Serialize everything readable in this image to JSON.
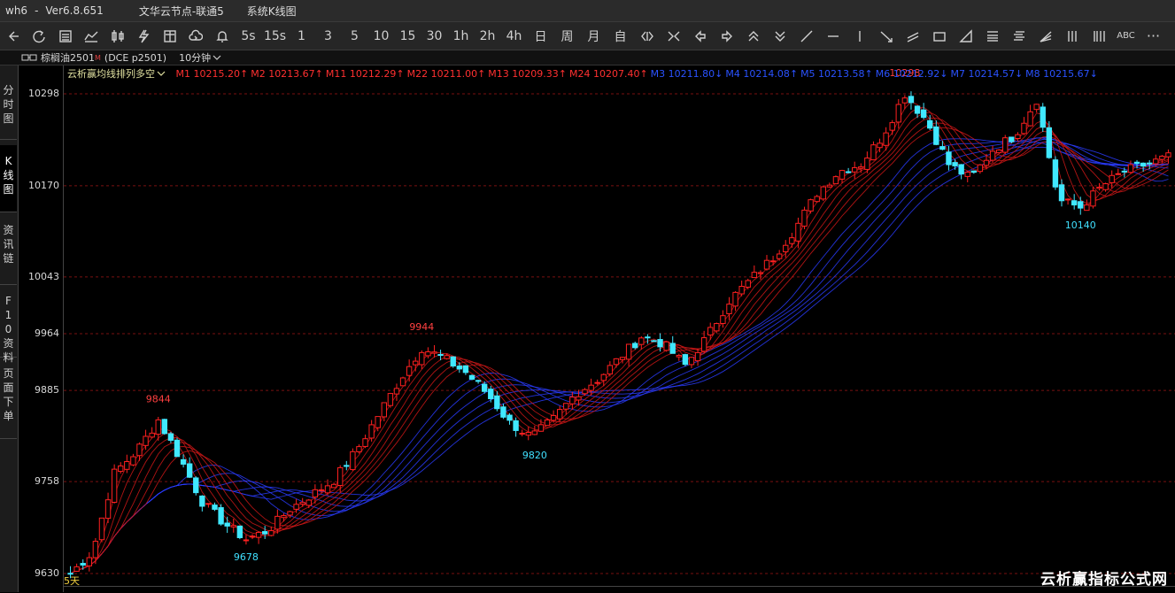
{
  "titlebar": {
    "app": "wh6",
    "sep": "-",
    "version": "Ver6.8.651",
    "node": "文华云节点-联通5",
    "view": "系统K线图"
  },
  "toolbar": {
    "text_buttons": [
      "5s",
      "15s",
      "1",
      "3",
      "5",
      "10",
      "15",
      "30",
      "1h",
      "2h",
      "4h",
      "日",
      "周",
      "月",
      "自"
    ],
    "abc": "ABC",
    "more": "···"
  },
  "infobar": {
    "symbol": "棕榈油2501",
    "sup": "M",
    "code": "(DCE p2501)",
    "period": "10分钟"
  },
  "sidebar": [
    "分时图",
    "K线图",
    "资讯链",
    "F10资料",
    "页面下单"
  ],
  "legend": {
    "name": "云析赢均线排列多空",
    "items": [
      {
        "text": "M1 10215.20↑",
        "color": "#ff3030"
      },
      {
        "text": "M2 10213.67↑",
        "color": "#ff3030"
      },
      {
        "text": "M11 10212.29↑",
        "color": "#ff3030"
      },
      {
        "text": "M22 10211.00↑",
        "color": "#ff3030"
      },
      {
        "text": "M13 10209.33↑",
        "color": "#ff3030"
      },
      {
        "text": "M24 10207.40↑",
        "color": "#ff3030"
      },
      {
        "text": "M3 10211.80↓",
        "color": "#2a52ff"
      },
      {
        "text": "M4 10214.08↑",
        "color": "#2a52ff"
      },
      {
        "text": "M5 10213.58↑",
        "color": "#2a52ff"
      },
      {
        "text": "M6 10212.92↓",
        "color": "#2a52ff"
      },
      {
        "text": "M7 10214.57↓",
        "color": "#2a52ff"
      },
      {
        "text": "M8 10215.67↓",
        "color": "#2a52ff"
      }
    ]
  },
  "yaxis_labels": [
    "10298",
    "10170",
    "10043",
    "9964",
    "9885",
    "9758",
    "9630"
  ],
  "annotations": [
    {
      "text": "9844",
      "color": "#ff4040"
    },
    {
      "text": "9678",
      "color": "#40e0ff"
    },
    {
      "text": "9944",
      "color": "#ff4040"
    },
    {
      "text": "9820",
      "color": "#40e0ff"
    },
    {
      "text": "10298",
      "color": "#ff4040"
    },
    {
      "text": "10140",
      "color": "#40e0ff"
    }
  ],
  "fiveday": "5天",
  "watermark": "云析赢指标公式网",
  "chart_data": {
    "type": "candlestick",
    "ylim": [
      9630,
      10298
    ],
    "price_path": [
      9630,
      9660,
      9770,
      9800,
      9844,
      9790,
      9730,
      9700,
      9678,
      9690,
      9720,
      9740,
      9760,
      9800,
      9850,
      9900,
      9944,
      9930,
      9910,
      9880,
      9840,
      9820,
      9845,
      9880,
      9900,
      9930,
      9960,
      9950,
      9920,
      9960,
      10010,
      10040,
      10070,
      10110,
      10160,
      10190,
      10200,
      10240,
      10298,
      10260,
      10200,
      10180,
      10220,
      10240,
      10290,
      10150,
      10140,
      10170,
      10190,
      10200,
      10210
    ]
  }
}
